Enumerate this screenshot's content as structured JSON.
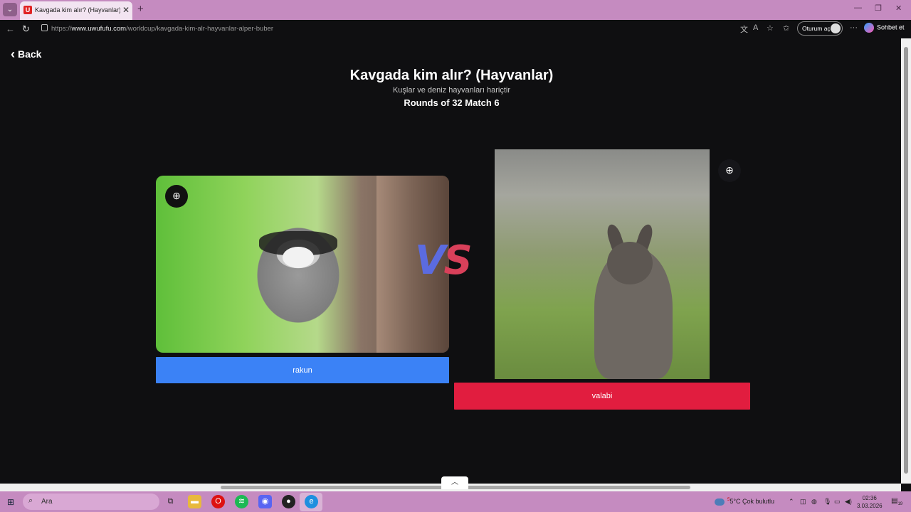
{
  "browser": {
    "tab_title": "Kavgada kim alır? (Hayvanlar) | Uwufufu",
    "tab_favicon_letter": "U",
    "new_tab_icon": "+",
    "url_prefix": "https://",
    "url_host": "www.uwufufu.com",
    "url_path": "/worldcup/kavgada-kim-alr-hayvanlar-alper-buber",
    "signin_label": "Oturum aç",
    "copilot_label": "Sohbet et"
  },
  "page": {
    "back_label": "Back",
    "title": "Kavgada kim alır? (Hayvanlar)",
    "subtitle": "Kuşlar ve deniz hayvanları hariçtir",
    "round_label": "Rounds of 32 Match 6",
    "vs_v": "V",
    "vs_s": "S",
    "left_choice": {
      "label": "rakun",
      "color": "#3b82f6"
    },
    "right_choice": {
      "label": "valabi",
      "color": "#e11d3f"
    }
  },
  "taskbar": {
    "search_placeholder": "Ara",
    "weather": "5°C  Çok bulutlu",
    "weather_badge": "5",
    "time": "02:36",
    "date": "3.03.2026",
    "notification_count": "19"
  }
}
